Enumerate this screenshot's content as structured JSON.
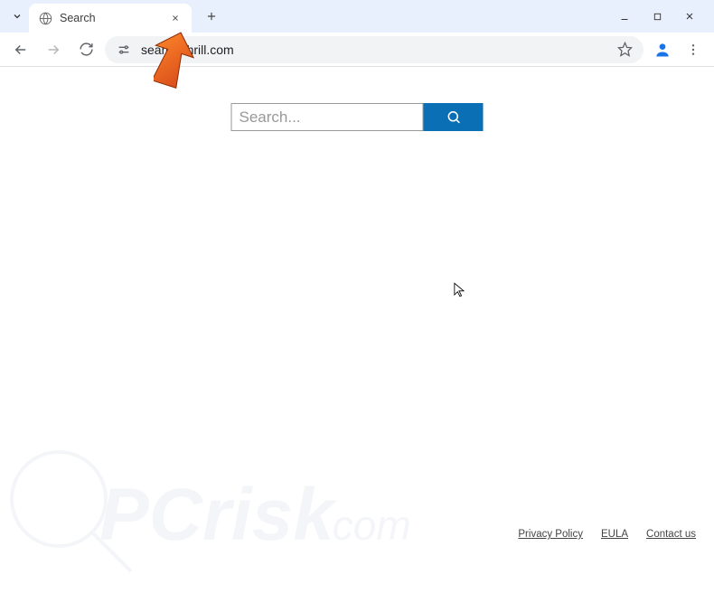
{
  "browser": {
    "tab_title": "Search",
    "url": "search-thrill.com"
  },
  "search": {
    "placeholder": "Search..."
  },
  "footer": {
    "privacy": "Privacy Policy",
    "eula": "EULA",
    "contact": "Contact us"
  },
  "watermark": {
    "text": "PCrisk.com"
  },
  "colors": {
    "search_button": "#0a6fb5",
    "chrome_tab_bg": "#e8f0fe"
  }
}
